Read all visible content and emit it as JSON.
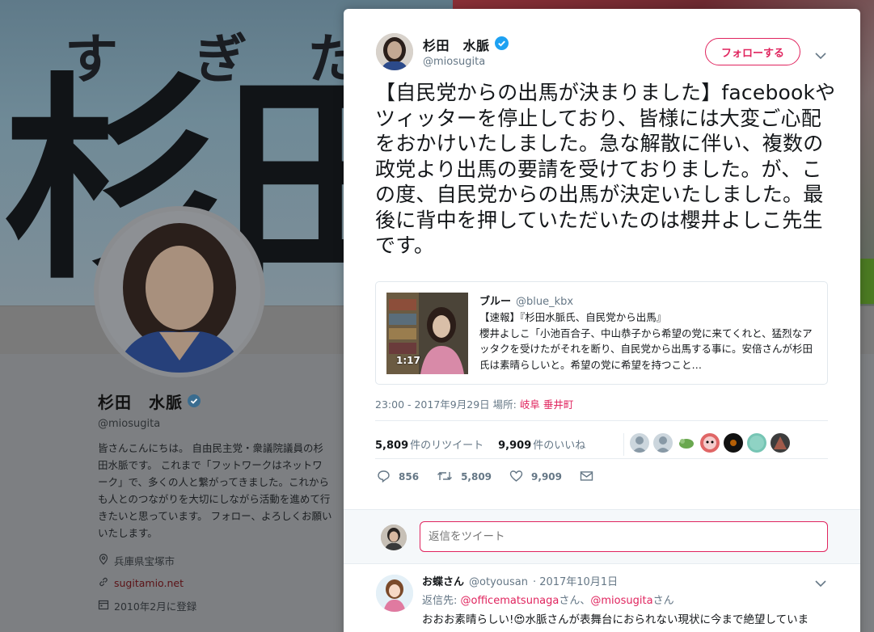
{
  "background": {
    "banner": {
      "kana": [
        "す",
        "ぎ",
        "た"
      ],
      "kanji": "杉田"
    },
    "profile": {
      "name": "杉田　水脈",
      "handle": "@miosugita",
      "bio": "皆さんこんにちは。 自由民主党・衆議院議員の杉田水脈です。 これまで「フットワークはネットワーク」で、多くの人と繋がってきました。これからも人とのつながりを大切にしながら活動を進めて行きたいと思っています。 フォロー、よろしくお願いいたします。",
      "location": "兵庫県宝塚市",
      "website": "sugitamio.net",
      "joined": "2010年2月に登録"
    }
  },
  "tweet": {
    "author_name": "杉田　水脈",
    "author_handle": "@miosugita",
    "follow_label": "フォローする",
    "text": "【自民党からの出馬が決まりました】facebookやツィッターを停止しており、皆様には大変ご心配をおかけいたしました。急な解散に伴い、複数の政党より出馬の要請を受けておりました。が、この度、自民党からの出馬が決定いたしました。最後に背中を押していただいたのは櫻井よしこ先生です。",
    "quote": {
      "name": "ブルー",
      "handle": "@blue_kbx",
      "line1": "【速報】『杉田水脈氏、自民党から出馬』",
      "line2": "櫻井よしこ「小池百合子、中山恭子から希望の党に来てくれと、猛烈なアッタクを受けたがそれを断り、自民党から出馬する事に。安倍さんが杉田氏は素晴らしいと。希望の党に希望を持つこと…",
      "duration": "1:17"
    },
    "timestamp": "23:00 - 2017年9月29日",
    "location_label": "場所:",
    "location": "岐阜 垂井町",
    "retweets_count": "5,809",
    "retweets_label": "件のリツイート",
    "likes_count": "9,909",
    "likes_label": "件のいいね",
    "actions": {
      "replies": "856",
      "retweets": "5,809",
      "likes": "9,909"
    }
  },
  "reply_box": {
    "placeholder": "返信をツイート"
  },
  "reply": {
    "name": "お蝶さん",
    "handle": "@otyousan",
    "date": "· 2017年10月1日",
    "to_label": "返信先:",
    "to_user1": "@officematsunaga",
    "san1": "さん、",
    "to_user2": "@miosugita",
    "san2": "さん",
    "text": "おおお素晴らしい!😍水脈さんが表舞台におられない現状に今まで絶望していま"
  },
  "colors": {
    "accent": "#e0245e",
    "verified": "#1da1f2",
    "muted": "#657786"
  },
  "icons": [
    "verified-badge-icon",
    "chevron-down-icon",
    "reply-icon",
    "retweet-icon",
    "like-icon",
    "dm-icon",
    "location-icon",
    "link-icon",
    "calendar-icon"
  ]
}
